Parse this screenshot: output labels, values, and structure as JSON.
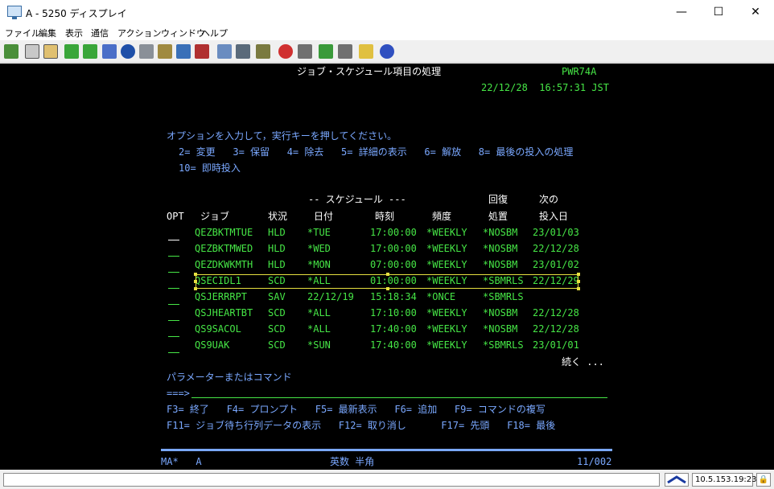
{
  "window": {
    "title": "A - 5250 ディスプレイ",
    "minimize": "—",
    "maximize": "☐",
    "close": "✕"
  },
  "menu": [
    "ファイル",
    "編集",
    "表示",
    "通信",
    "アクション",
    "ウィンドウ",
    "ヘルプ"
  ],
  "toolbar_icons": [
    "copy-icon",
    "paste-icon",
    "paste-special-icon",
    "upload-icon",
    "download-icon",
    "macro-icon",
    "navigator-icon",
    "document-icon",
    "package-icon",
    "network-icon",
    "table-icon",
    "keyboard-icon",
    "pencil-icon",
    "record-icon",
    "stop-icon",
    "play-icon",
    "pause-icon",
    "notes-icon",
    "help-icon"
  ],
  "screen": {
    "title": "ジョブ・スケジュール項目の処理",
    "system": "PWR74A",
    "datetime": "22/12/28  16:57:31 JST",
    "instruction": "オプションを入力して，実行キーを押してください。",
    "options_line1": "2= 変更   3= 保留   4= 除去   5= 詳細の表示   6= 解放   8= 最後の投入の処理",
    "options_line2": "10= 即時投入",
    "col_schedule": "-- スケジュール ---",
    "col_recovery": "回復",
    "col_next": "次の",
    "headers": {
      "opt": "OPT",
      "job": "ジョブ",
      "status": "状況",
      "date": "日付",
      "time": "時刻",
      "freq": "頻度",
      "action": "処置",
      "submit": "投入日"
    },
    "rows": [
      {
        "job": "QEZBKTMTUE",
        "status": "HLD",
        "date": "*TUE",
        "time": "17:00:00",
        "freq": "*WEEKLY",
        "action": "*NOSBM",
        "next": "23/01/03"
      },
      {
        "job": "QEZBKTMWED",
        "status": "HLD",
        "date": "*WED",
        "time": "17:00:00",
        "freq": "*WEEKLY",
        "action": "*NOSBM",
        "next": "22/12/28"
      },
      {
        "job": "QEZDKWKMTH",
        "status": "HLD",
        "date": "*MON",
        "time": "07:00:00",
        "freq": "*WEEKLY",
        "action": "*NOSBM",
        "next": "23/01/02"
      },
      {
        "job": "QSECIDL1",
        "status": "SCD",
        "date": "*ALL",
        "time": "01:00:00",
        "freq": "*WEEKLY",
        "action": "*SBMRLS",
        "next": "22/12/29"
      },
      {
        "job": "QSJERRRPT",
        "status": "SAV",
        "date": "22/12/19",
        "time": "15:18:34",
        "freq": "*ONCE",
        "action": "*SBMRLS",
        "next": ""
      },
      {
        "job": "QSJHEARTBT",
        "status": "SCD",
        "date": "*ALL",
        "time": "17:10:00",
        "freq": "*WEEKLY",
        "action": "*NOSBM",
        "next": "22/12/28"
      },
      {
        "job": "QS9SACOL",
        "status": "SCD",
        "date": "*ALL",
        "time": "17:40:00",
        "freq": "*WEEKLY",
        "action": "*NOSBM",
        "next": "22/12/28"
      },
      {
        "job": "QS9UAK",
        "status": "SCD",
        "date": "*SUN",
        "time": "17:40:00",
        "freq": "*WEEKLY",
        "action": "*SBMRLS",
        "next": "23/01/01"
      }
    ],
    "more": "続く ...",
    "param_label": "パラメーターまたはコマンド",
    "prompt": "===>",
    "fkeys1": "F3= 終了   F4= プロンプト   F5= 最新表示   F6= 追加   F9= コマンドの複写",
    "fkeys2": "F11= ジョブ待ち行列データの表示   F12= 取り消し      F17= 先頭   F18= 最後",
    "oia_left": "MA*   A",
    "oia_mid": "英数 半角",
    "oia_right": "11/002"
  },
  "statusbar": {
    "ip": "10.5.153.19:23"
  },
  "colors": {
    "screen_bg": "#000000",
    "green": "#46e646",
    "blue": "#7aa8ff",
    "white": "#ffffff",
    "cyan": "#78dce8",
    "selection": "#e6e040"
  }
}
